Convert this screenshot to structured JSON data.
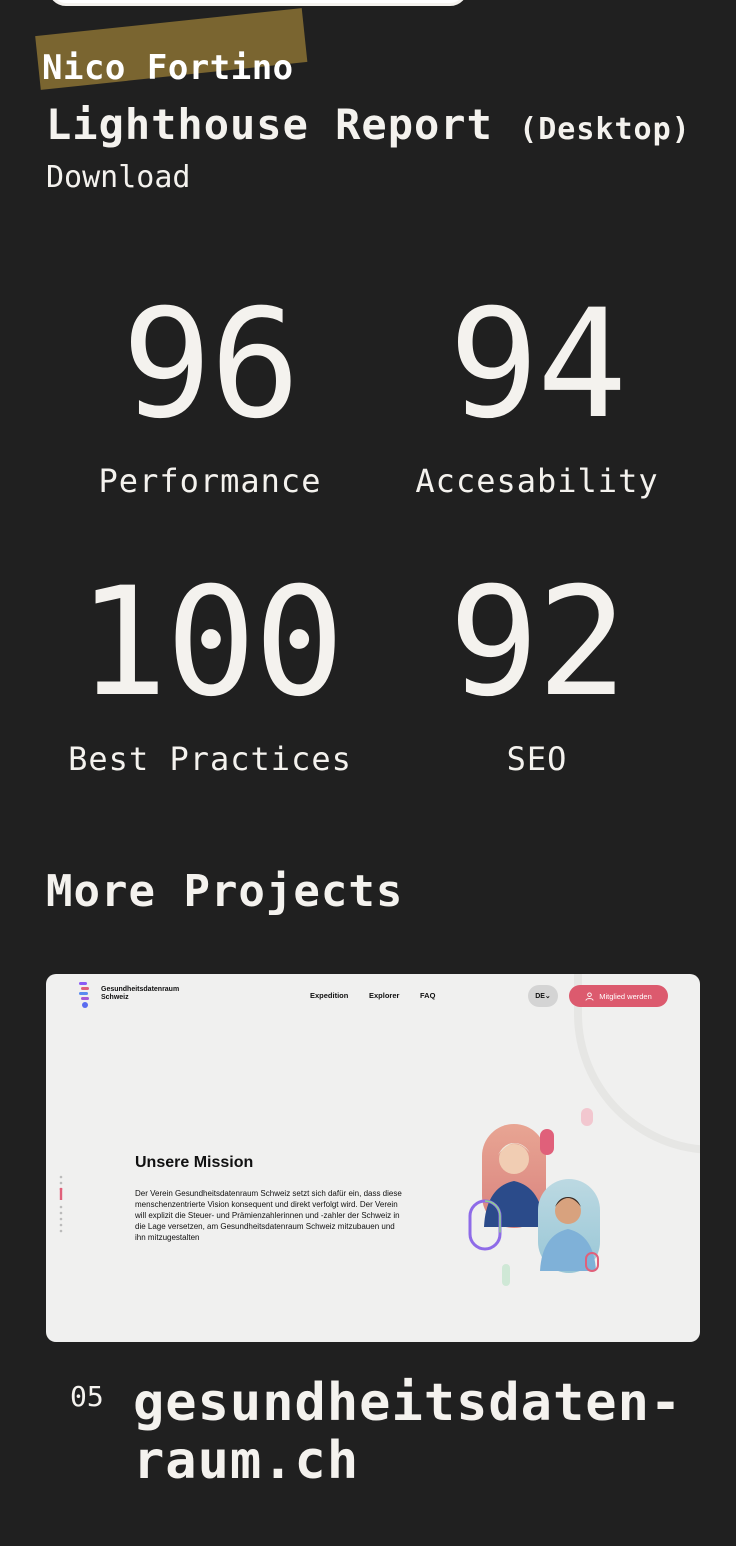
{
  "header": {
    "brand_name": "Nico Fortino",
    "report_title": "Lighthouse Report",
    "report_subtitle": "(Desktop)",
    "download_label": "Download"
  },
  "scores": [
    {
      "value": "96",
      "label": "Performance"
    },
    {
      "value": "94",
      "label": "Accesability"
    },
    {
      "value": "100",
      "label": "Best Practices"
    },
    {
      "value": "92",
      "label": "SEO"
    }
  ],
  "more_projects": {
    "heading": "More Projects",
    "project": {
      "number": "05",
      "title_line1": "gesundheitsdaten-",
      "title_line2": "raum.ch",
      "preview": {
        "logo_line1": "Gesundheitsdatenraum",
        "logo_line2": "Schweiz",
        "nav": [
          "Expedition",
          "Explorer",
          "FAQ"
        ],
        "lang": "DE",
        "cta": "Mitglied werden",
        "heading": "Unsere Mission",
        "body": "Der Verein Gesundheitsdatenraum Schweiz setzt sich dafür ein, dass diese menschenzentrierte Vision konsequent und direkt verfolgt wird. Der Verein will explizit die Steuer- und Prämienzahlerinnen und -zahler der Schweiz in die Lage versetzen, am Gesundheitsdatenraum Schweiz mitzubauen und ihn mitzugestalten"
      }
    }
  },
  "colors": {
    "background": "#202020",
    "text": "#f4f2ee",
    "brand_strip": "#7a6530",
    "cta": "#dc5a6e"
  }
}
